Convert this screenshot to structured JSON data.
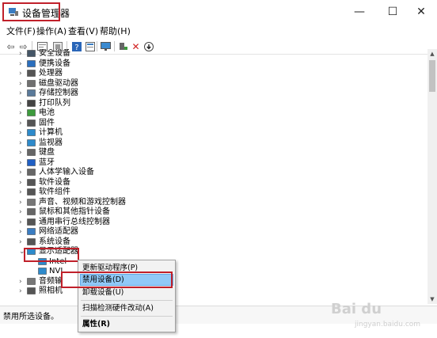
{
  "window": {
    "title": "设备管理器"
  },
  "window_controls": {
    "minimize": "—",
    "maximize": "☐",
    "close": "✕"
  },
  "menu": [
    "文件(F)",
    "操作(A)",
    "查看(V)",
    "帮助(H)"
  ],
  "toolbar_icons": [
    "back-arrow-icon",
    "forward-arrow-icon",
    "properties-icon",
    "driver-icon",
    "help-icon",
    "view-icon",
    "monitor-icon",
    "add-driver-icon",
    "uninstall-icon",
    "update-driver-icon"
  ],
  "tree": {
    "categories": [
      {
        "label": "安全设备",
        "icon": "security-device-icon",
        "color": "#445566"
      },
      {
        "label": "便携设备",
        "icon": "portable-device-icon",
        "color": "#2a6ebd"
      },
      {
        "label": "处理器",
        "icon": "processor-icon",
        "color": "#555555"
      },
      {
        "label": "磁盘驱动器",
        "icon": "disk-drive-icon",
        "color": "#6f6f6f"
      },
      {
        "label": "存储控制器",
        "icon": "storage-controller-icon",
        "color": "#5a7a9a"
      },
      {
        "label": "打印队列",
        "icon": "print-queue-icon",
        "color": "#444444"
      },
      {
        "label": "电池",
        "icon": "battery-icon",
        "color": "#3d9b3d"
      },
      {
        "label": "固件",
        "icon": "firmware-icon",
        "color": "#555555"
      },
      {
        "label": "计算机",
        "icon": "computer-icon",
        "color": "#2d8acb"
      },
      {
        "label": "监视器",
        "icon": "monitor-icon",
        "color": "#2d8acb"
      },
      {
        "label": "键盘",
        "icon": "keyboard-icon",
        "color": "#666666"
      },
      {
        "label": "蓝牙",
        "icon": "bluetooth-icon",
        "color": "#1f5fc4"
      },
      {
        "label": "人体学输入设备",
        "icon": "hid-icon",
        "color": "#666666"
      },
      {
        "label": "软件设备",
        "icon": "software-device-icon",
        "color": "#555555"
      },
      {
        "label": "软件组件",
        "icon": "software-component-icon",
        "color": "#555555"
      },
      {
        "label": "声音、视频和游戏控制器",
        "icon": "sound-icon",
        "color": "#777777"
      },
      {
        "label": "鼠标和其他指针设备",
        "icon": "mouse-icon",
        "color": "#666666"
      },
      {
        "label": "通用串行总线控制器",
        "icon": "usb-icon",
        "color": "#555555"
      },
      {
        "label": "网络适配器",
        "icon": "network-adapter-icon",
        "color": "#3a7dc2"
      },
      {
        "label": "系统设备",
        "icon": "system-device-icon",
        "color": "#555555"
      },
      {
        "label": "显示适配器",
        "icon": "display-adapter-icon",
        "color": "#2d8acb"
      },
      {
        "label": "Intel",
        "icon": "gpu-icon",
        "color": "#2d8acb"
      },
      {
        "label": "NVI",
        "icon": "gpu-icon",
        "color": "#2d8acb"
      },
      {
        "label": "音频输",
        "icon": "audio-icon",
        "color": "#777777"
      },
      {
        "label": "照相机",
        "icon": "camera-icon",
        "color": "#555555"
      }
    ]
  },
  "context_menu": {
    "update_driver": "更新驱动程序(P)",
    "disable_device": "禁用设备(D)",
    "uninstall_device": "卸载设备(U)",
    "scan_hardware": "扫描检测硬件改动(A)",
    "properties": "属性(R)"
  },
  "status": {
    "text": "禁用所选设备。"
  },
  "watermark": {
    "text": "Bai du",
    "sub": "jingyan.baidu.com"
  }
}
